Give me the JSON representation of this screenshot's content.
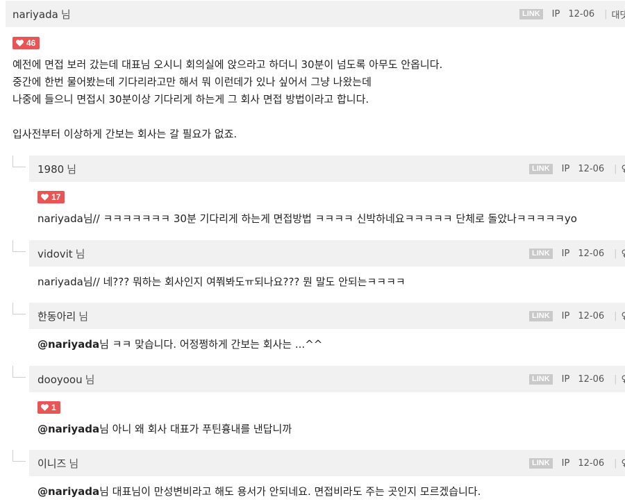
{
  "labels": {
    "nim": "님",
    "link": "LINK",
    "ip": "IP",
    "sep": "|"
  },
  "colors": {
    "accent_like": "#e95454",
    "header_bg": "#f1f1f1"
  },
  "main_comment": {
    "user": "nariyada",
    "date": "12-06",
    "action": "대댓",
    "likes": "46",
    "lines": [
      "예전에 면접 보러 갔는데 대표님 오시니 회의실에 앉으라고 하더니 30분이 넘도록 아무도 안옵니다.",
      "중간에 한번 물어봤는데 기다리라고만 해서 뭐 이런데가 있나 싶어서 그냥 나왔는데",
      "나중에 들으니 면접시 30분이상 기다리게 하는게 그 회사 면접 방법이라고 합니다.",
      "",
      "입사전부터 이상하게 간보는 회사는 갈 필요가 없죠."
    ]
  },
  "replies": [
    {
      "user": "1980",
      "date": "12-06",
      "action": "♀",
      "likes": "17",
      "mention": "",
      "text": "nariyada님// ㅋㅋㅋㅋㅋㅋㅋ 30분 기다리게 하는게 면접방법 ㅋㅋㅋㅋ 신박하네요ㅋㅋㅋㅋㅋ 단체로 돌았나ㅋㅋㅋㅋㅋyo"
    },
    {
      "user": "vidovit",
      "date": "12-06",
      "action": "♀",
      "likes": "",
      "mention": "",
      "text": "nariyada님// 네??? 뭐하는 회사인지 여쭤봐도ㅠ되나요??? 뭔 말도 안되는ㅋㅋㅋㅋ"
    },
    {
      "user": "한동아리",
      "date": "12-06",
      "action": "♀",
      "likes": "",
      "mention": "@nariyada",
      "text": "님 ㅋㅋ 맞습니다. 어정쩡하게 간보는 회사는 ...^^"
    },
    {
      "user": "dooyoou",
      "date": "12-06",
      "action": "♀",
      "likes": "1",
      "mention": "@nariyada",
      "text": "님 아니 왜 회사 대표가 푸틴흉내를 낸답니까"
    },
    {
      "user": "이니즈",
      "date": "12-06",
      "action": "♀",
      "likes": "",
      "mention": "@nariyada",
      "text": "님 대표님이 만성변비라고 해도 용서가 안되네요. 면접비라도 주는 곳인지 모르겠습니다."
    }
  ]
}
